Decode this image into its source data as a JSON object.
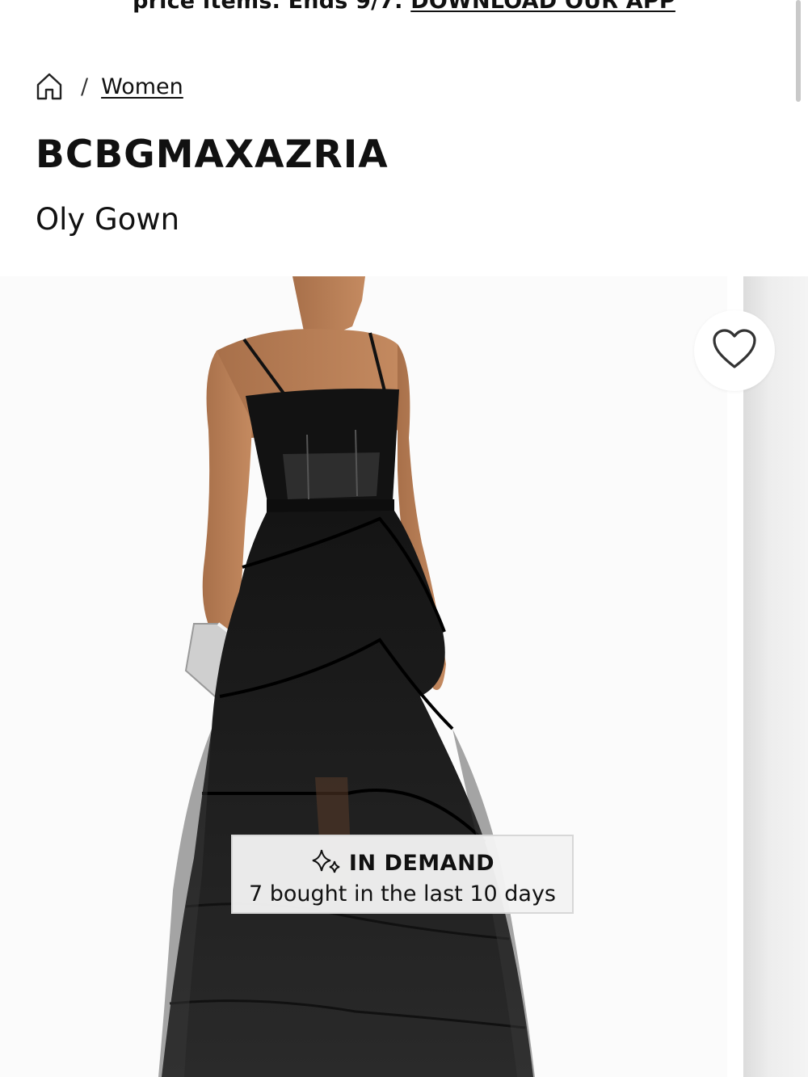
{
  "promo": {
    "text": "price items. Ends 9/7.",
    "link": "DOWNLOAD OUR APP"
  },
  "breadcrumb": {
    "home_icon": "home-icon",
    "separator": "/",
    "items": [
      {
        "label": "Women"
      }
    ]
  },
  "product": {
    "brand": "BCBGMAXAZRIA",
    "name": "Oly Gown"
  },
  "gallery": {
    "favorite_icon": "heart-outline-icon"
  },
  "badge": {
    "icon": "sparkle-icon",
    "title": "IN DEMAND",
    "subtitle": "7 bought in the last 10 days"
  }
}
